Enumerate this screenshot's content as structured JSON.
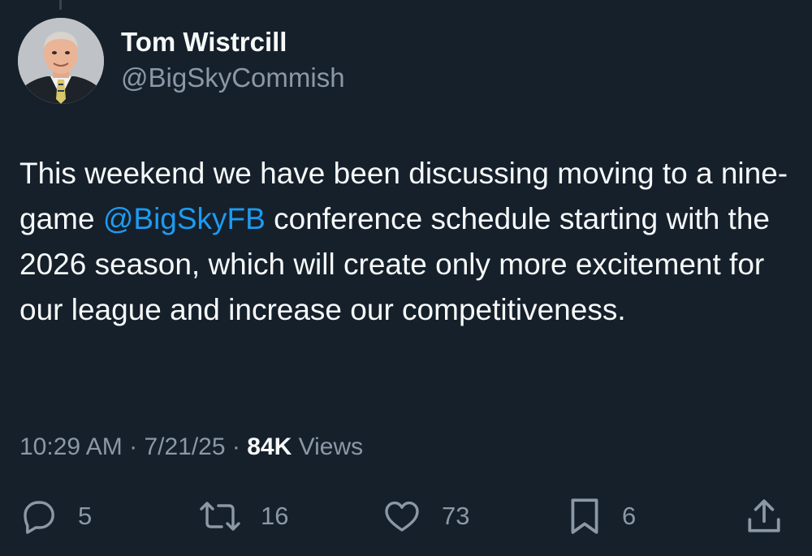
{
  "author": {
    "display_name": "Tom Wistrcill",
    "handle": "@BigSkyCommish"
  },
  "tweet": {
    "text_before": "This weekend we have been discussing moving to a nine-game ",
    "mention": "@BigSkyFB",
    "text_after": " conference schedule starting with the 2026 season, which will create only more excitement for our league and increase our competitiveness."
  },
  "meta": {
    "time": "10:29 AM",
    "separator1": "·",
    "date": "7/21/25",
    "separator2": "·",
    "views_count": "84K",
    "views_label": "Views"
  },
  "actions": {
    "replies": "5",
    "reposts": "16",
    "likes": "73",
    "bookmarks": "6"
  },
  "icons": [
    "reply-icon",
    "repost-icon",
    "like-icon",
    "bookmark-icon",
    "share-icon"
  ],
  "colors": {
    "background": "#15202b",
    "text_primary": "#f7f9f9",
    "text_secondary": "#8b98a5",
    "accent": "#1d9bf0"
  }
}
